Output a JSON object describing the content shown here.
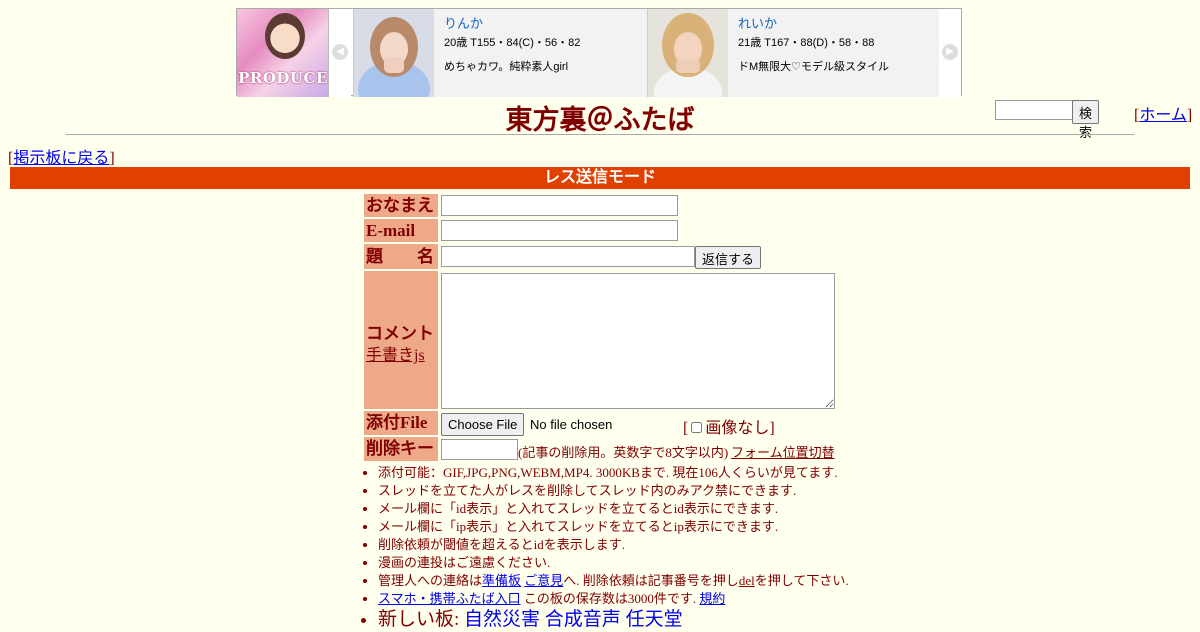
{
  "banner": {
    "logo_text": "PRODUCE",
    "cards": [
      {
        "name": "りんか",
        "stats": "20歳 T155・84(C)・56・82",
        "desc": "めちゃカワ。純粋素人girl"
      },
      {
        "name": "れいか",
        "stats": "21歳 T167・88(D)・58・88",
        "desc": "ドM無限大♡モデル級スタイル"
      }
    ],
    "prev_glyph": "◀",
    "next_glyph": "▶"
  },
  "header": {
    "title": "東方裏＠ふたば",
    "search_button": "検索",
    "home_link": "ホーム",
    "back_link": "掲示板に戻る"
  },
  "mode_bar": "レス送信モード",
  "form": {
    "name_label": "おなまえ",
    "email_label": "E-mail",
    "subject_label": "題　　名",
    "submit_button": "返信する",
    "comment_label": "コメント",
    "tegaki_link": "手書きjs",
    "file_label": "添付File",
    "choose_file_button": "Choose File",
    "no_file_text": "No file chosen",
    "no_image_label": "画像なし",
    "delkey_label": "削除キー",
    "delkey_note": "(記事の削除用。英数字で8文字以内)",
    "form_position_link": "フォーム位置切替"
  },
  "notes": [
    {
      "text": "添付可能：GIF,JPG,PNG,WEBM,MP4. 3000KBまで. 現在106人くらいが見てます."
    },
    {
      "text": "スレッドを立てた人がレスを削除してスレッド内のみアク禁にできます."
    },
    {
      "text": "メール欄に「id表示」と入れてスレッドを立てるとid表示にできます."
    },
    {
      "text": "メール欄に「ip表示」と入れてスレッドを立てるとip表示にできます."
    },
    {
      "text": "削除依頼が閾値を超えるとidを表示します."
    },
    {
      "text": "漫画の連投はご遠慮ください."
    }
  ],
  "contact": {
    "prefix": "管理人への連絡は",
    "link1": "準備板",
    "link2": "ご意見",
    "middle": "へ. 削除依頼は記事番号を押し",
    "del_link": "del",
    "suffix": "を押して下さい."
  },
  "mobile": {
    "link": "スマホ・携帯ふたば入口",
    "text": "この板の保存数は3000件です.",
    "rules_link": "規約"
  },
  "new_boards": {
    "label": "新しい板:",
    "boards": [
      "自然災害",
      "合成音声",
      "任天堂"
    ]
  },
  "colors": {
    "mode_bar": "#e04000",
    "label_bg": "#eeaa88",
    "page_bg": "#ffffee",
    "text": "#800000"
  }
}
